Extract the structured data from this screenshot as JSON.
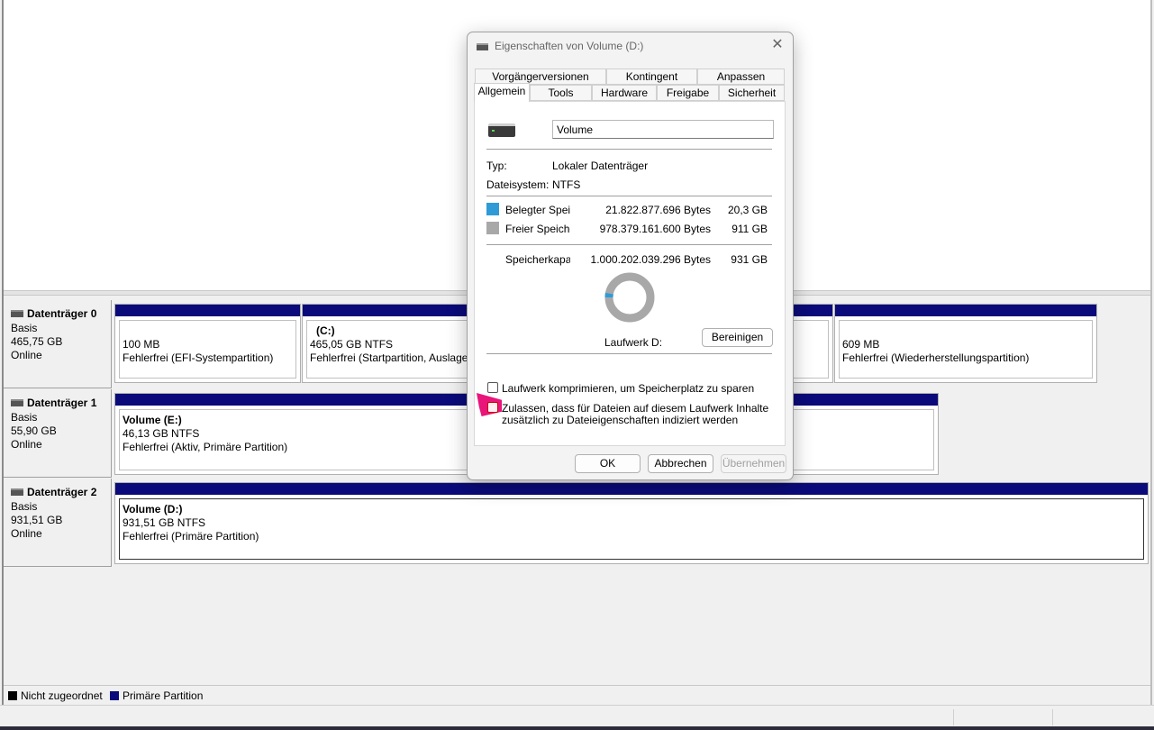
{
  "disks": [
    {
      "title": "Datenträger 0",
      "type": "Basis",
      "size": "465,75 GB",
      "status": "Online",
      "partitions": [
        {
          "title": "",
          "size": "100 MB",
          "status": "Fehlerfrei (EFI-Systempartition)"
        },
        {
          "title": "(C:)",
          "size": "465,05 GB NTFS",
          "status": "Fehlerfrei (Startpartition, Auslager"
        },
        {
          "title": "",
          "size": "609 MB",
          "status": "Fehlerfrei (Wiederherstellungspartition)"
        }
      ]
    },
    {
      "title": "Datenträger 1",
      "type": "Basis",
      "size": "55,90 GB",
      "status": "Online",
      "partitions": [
        {
          "title": "Volume  (E:)",
          "size": "46,13 GB NTFS",
          "status": "Fehlerfrei (Aktiv, Primäre Partition)"
        }
      ]
    },
    {
      "title": "Datenträger 2",
      "type": "Basis",
      "size": "931,51 GB",
      "status": "Online",
      "partitions": [
        {
          "title": "Volume  (D:)",
          "size": "931,51 GB NTFS",
          "status": "Fehlerfrei (Primäre Partition)"
        }
      ]
    }
  ],
  "legend": {
    "unallocated": "Nicht zugeordnet",
    "primary": "Primäre Partition",
    "unallocated_color": "#000000",
    "primary_color": "#0a0a7a"
  },
  "dialog": {
    "title": "Eigenschaften von Volume (D:)",
    "close_icon": "close-icon",
    "tabs_row1": [
      "Vorgängerversionen",
      "Kontingent",
      "Anpassen"
    ],
    "tabs_row2": [
      "Allgemein",
      "Tools",
      "Hardware",
      "Freigabe",
      "Sicherheit"
    ],
    "active_tab": "Allgemein",
    "volume_name": "Volume",
    "type_label": "Typ:",
    "type_value": "Lokaler Datenträger",
    "fs_label": "Dateisystem:",
    "fs_value": "NTFS",
    "used_label": "Belegter Speicl",
    "used_bytes": "21.822.877.696 Bytes",
    "used_gb": "20,3 GB",
    "used_color": "#2f9bd6",
    "free_label": "Freier Speicher",
    "free_bytes": "978.379.161.600 Bytes",
    "free_gb": "911 GB",
    "free_color": "#a8a8a8",
    "capacity_label": "Speicherkapazi",
    "capacity_bytes": "1.000.202.039.296 Bytes",
    "capacity_gb": "931 GB",
    "used_fraction": 0.0218,
    "drive_label": "Laufwerk D:",
    "cleanup_button": "Bereinigen",
    "compress_label": "Laufwerk komprimieren, um Speicherplatz zu sparen",
    "index_label_line1": "Zulassen, dass für Dateien auf diesem Laufwerk Inhalte",
    "index_label_line2": "zusätzlich zu Dateieigenschaften indiziert werden",
    "ok_button": "OK",
    "cancel_button": "Abbrechen",
    "apply_button": "Übernehmen"
  }
}
